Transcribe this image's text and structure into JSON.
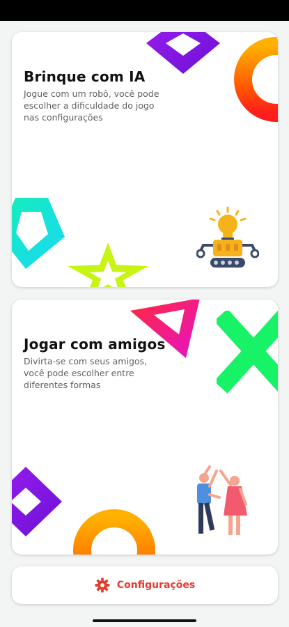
{
  "cards": {
    "ai": {
      "title": "Brinque com IA",
      "description": "Jogue com um robô, você pode escolher a dificuldade do jogo nas configurações",
      "illustration": "robot-icon"
    },
    "friends": {
      "title": "Jogar com amigos",
      "description": "Divirta-se com seus amigos, você pode escolher entre diferentes formas",
      "illustration": "friends-high-five-icon"
    }
  },
  "settings": {
    "label": "Configurações",
    "icon": "gear-icon",
    "color": "#e53b2f"
  },
  "colors": {
    "background": "#f3f4f4",
    "card": "#ffffff",
    "diamond_purple": "#8a17e6",
    "ring_orange": "#ff6a00",
    "pentagon_cyan": "#18e6d6",
    "star_lime": "#c6f516",
    "triangle_red": "#ff1e4a",
    "x_green": "#19f06a"
  }
}
